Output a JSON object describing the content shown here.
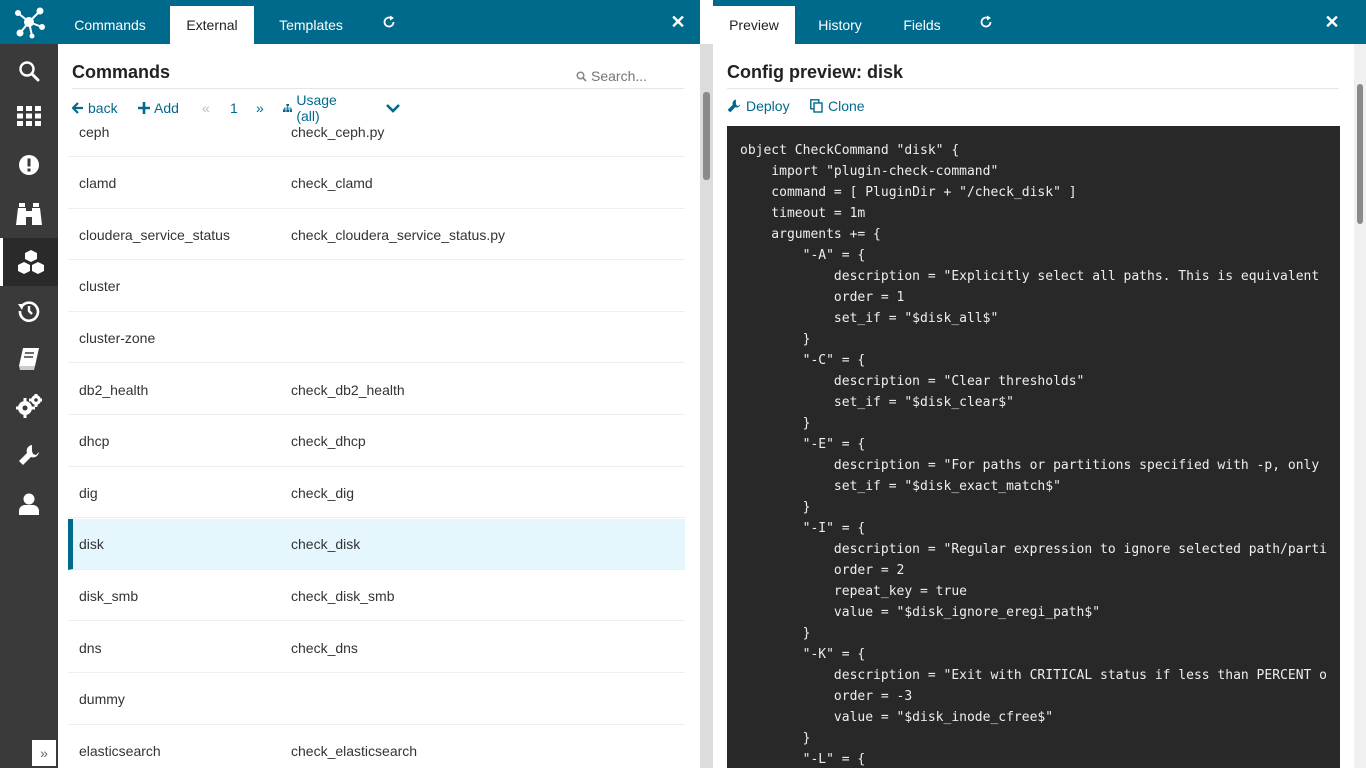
{
  "sidebar": {
    "logo": "logo-icon",
    "items": [
      {
        "icon": "search-icon"
      },
      {
        "icon": "dashboard-grid-icon"
      },
      {
        "icon": "alert-icon"
      },
      {
        "icon": "binoculars-icon"
      },
      {
        "icon": "cubes-icon",
        "active": true
      },
      {
        "icon": "history-icon"
      },
      {
        "icon": "book-icon"
      },
      {
        "icon": "gears-icon"
      },
      {
        "icon": "wrench-icon"
      },
      {
        "icon": "user-icon"
      }
    ],
    "collapse_glyph": "»"
  },
  "left": {
    "tabs": [
      {
        "label": "Commands"
      },
      {
        "label": "External"
      },
      {
        "label": "Templates"
      }
    ],
    "title": "Commands",
    "search_placeholder": "Search...",
    "controls": {
      "back": "back",
      "add": "Add",
      "prev": "«",
      "page": "1",
      "next": "»",
      "usage": "Usage (all)"
    },
    "rows": [
      {
        "name": "ceph",
        "command": "check_ceph.py"
      },
      {
        "name": "clamd",
        "command": "check_clamd"
      },
      {
        "name": "cloudera_service_status",
        "command": "check_cloudera_service_status.py"
      },
      {
        "name": "cluster",
        "command": ""
      },
      {
        "name": "cluster-zone",
        "command": ""
      },
      {
        "name": "db2_health",
        "command": "check_db2_health"
      },
      {
        "name": "dhcp",
        "command": "check_dhcp"
      },
      {
        "name": "dig",
        "command": "check_dig"
      },
      {
        "name": "disk",
        "command": "check_disk",
        "selected": true
      },
      {
        "name": "disk_smb",
        "command": "check_disk_smb"
      },
      {
        "name": "dns",
        "command": "check_dns"
      },
      {
        "name": "dummy",
        "command": ""
      },
      {
        "name": "elasticsearch",
        "command": "check_elasticsearch"
      }
    ]
  },
  "right": {
    "tabs": [
      {
        "label": "Preview"
      },
      {
        "label": "History"
      },
      {
        "label": "Fields"
      }
    ],
    "title": "Config preview: disk",
    "actions": {
      "deploy": "Deploy",
      "clone": "Clone"
    },
    "code": "object CheckCommand \"disk\" {\n    import \"plugin-check-command\"\n    command = [ PluginDir + \"/check_disk\" ]\n    timeout = 1m\n    arguments += {\n        \"-A\" = {\n            description = \"Explicitly select all paths. This is equivalent\n            order = 1\n            set_if = \"$disk_all$\"\n        }\n        \"-C\" = {\n            description = \"Clear thresholds\"\n            set_if = \"$disk_clear$\"\n        }\n        \"-E\" = {\n            description = \"For paths or partitions specified with -p, only\n            set_if = \"$disk_exact_match$\"\n        }\n        \"-I\" = {\n            description = \"Regular expression to ignore selected path/parti\n            order = 2\n            repeat_key = true\n            value = \"$disk_ignore_eregi_path$\"\n        }\n        \"-K\" = {\n            description = \"Exit with CRITICAL status if less than PERCENT o\n            order = -3\n            value = \"$disk_inode_cfree$\"\n        }\n        \"-L\" = {"
  },
  "colors": {
    "brand": "#006a8c",
    "sidebar": "#3a3a3a",
    "code_bg": "#282828",
    "selected_row": "#e5f7fd"
  }
}
